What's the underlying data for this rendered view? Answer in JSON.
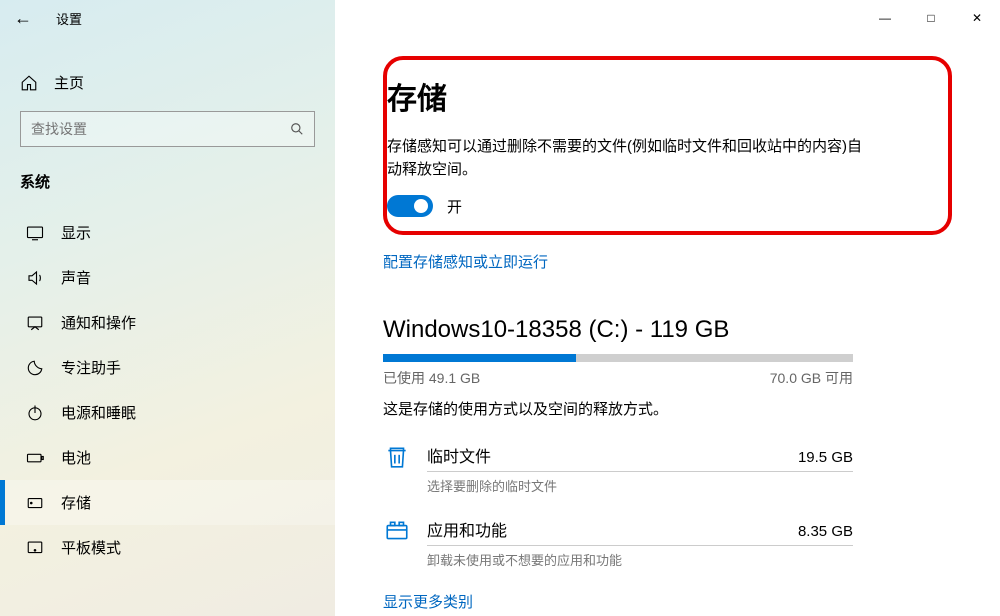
{
  "window": {
    "title": "设置",
    "controls": {
      "minimize": "—",
      "maximize": "□",
      "close": "✕"
    }
  },
  "sidebar": {
    "home_label": "主页",
    "search_placeholder": "查找设置",
    "section": "系统",
    "items": [
      {
        "label": "显示",
        "icon": "display"
      },
      {
        "label": "声音",
        "icon": "sound"
      },
      {
        "label": "通知和操作",
        "icon": "notifications"
      },
      {
        "label": "专注助手",
        "icon": "focus"
      },
      {
        "label": "电源和睡眠",
        "icon": "power"
      },
      {
        "label": "电池",
        "icon": "battery"
      },
      {
        "label": "存储",
        "icon": "storage",
        "active": true
      },
      {
        "label": "平板模式",
        "icon": "tablet"
      }
    ]
  },
  "main": {
    "page_title": "存储",
    "sense_desc": "存储感知可以通过删除不需要的文件(例如临时文件和回收站中的内容)自动释放空间。",
    "toggle_state_label": "开",
    "configure_link": "配置存储感知或立即运行",
    "drive": {
      "title": "Windows10-18358 (C:) - 119 GB",
      "used_label": "已使用",
      "used_value": "49.1 GB",
      "free_value": "70.0 GB",
      "free_label": "可用",
      "fill_percent": 41,
      "desc": "这是存储的使用方式以及空间的释放方式。"
    },
    "categories": [
      {
        "name": "临时文件",
        "size": "19.5 GB",
        "sub": "选择要删除的临时文件",
        "icon": "trash"
      },
      {
        "name": "应用和功能",
        "size": "8.35 GB",
        "sub": "卸载未使用或不想要的应用和功能",
        "icon": "apps"
      }
    ],
    "more_link": "显示更多类别"
  }
}
